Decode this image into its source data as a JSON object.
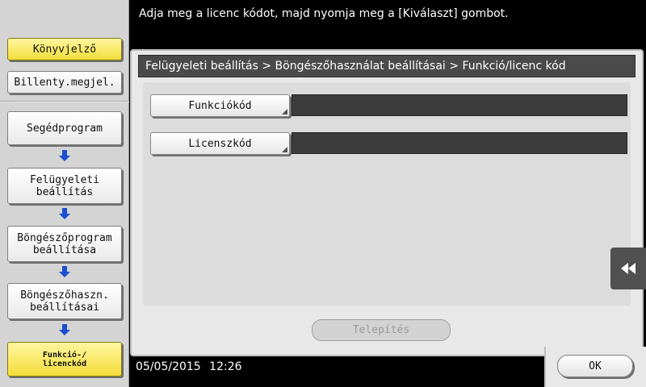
{
  "instruction": "Adja meg a licenc kódot, majd nyomja meg a [Kiválaszt] gombot.",
  "sidebar": {
    "bookmark": "Könyvjelző",
    "keyboard": "Billenty.megjel.",
    "steps": [
      "Segédprogram",
      "Felügyeleti\nbeállítás",
      "Böngészőprogram\nbeállítása",
      "Böngészőhaszn.\nbeállításai",
      "Funkció-/\nlicenckód"
    ]
  },
  "breadcrumb": "Felügyeleti beállítás > Böngészőhasználat beállításai > Funkció/licenc kód",
  "fields": {
    "function_code": {
      "label": "Funkciókód",
      "value": ""
    },
    "license_code": {
      "label": "Licenszkód",
      "value": ""
    }
  },
  "install_label": "Telepítés",
  "ok_label": "OK",
  "datetime": {
    "date": "05/05/2015",
    "time": "12:26"
  },
  "colors": {
    "accent_yellow": "#f3dd3a",
    "arrow_blue": "#1a4fd0",
    "field_dark": "#3c3c3c"
  },
  "icons": {
    "step_arrow": "down-arrow-icon",
    "side_tab": "rewind-icon"
  }
}
